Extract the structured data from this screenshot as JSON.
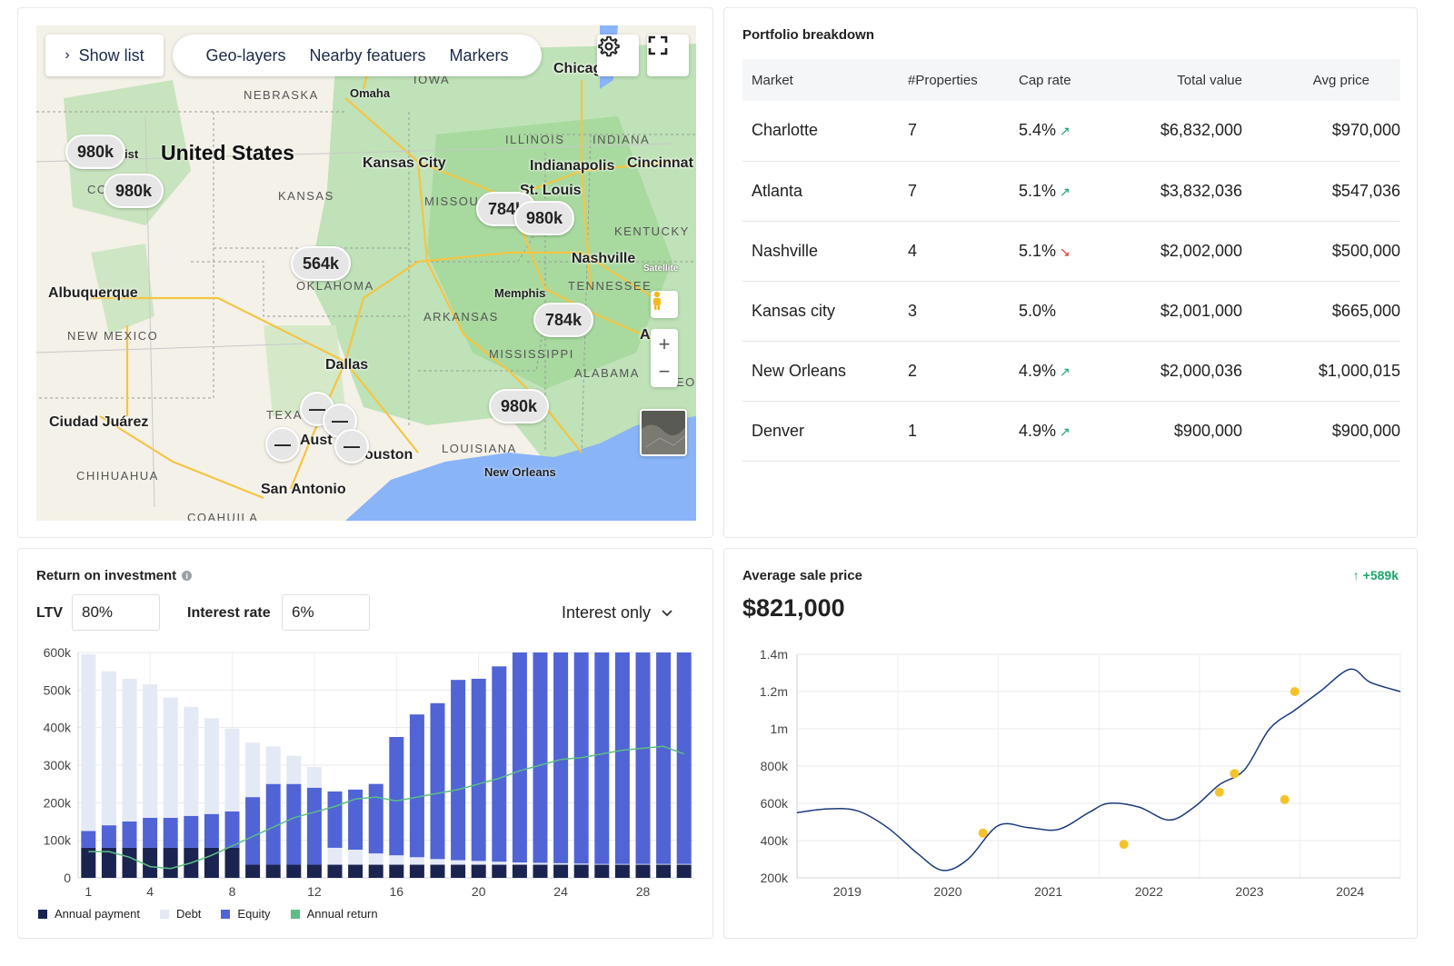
{
  "map": {
    "show_list_label": "Show list",
    "tabs": [
      "Geo-layers",
      "Nearby featuers",
      "Markers"
    ],
    "settings_icon": "gear-icon",
    "fullscreen_icon": "fullscreen-icon",
    "zoom_in": "+",
    "zoom_out": "−",
    "satellite_label": "Satellite",
    "labels": {
      "country": "United States",
      "nebraska": "NEBRASKA",
      "iowa": "IOWA",
      "omaha": "Omaha",
      "illinois": "ILLINOIS",
      "indiana": "INDIANA",
      "chicago": "Chicag",
      "kansas_city": "Kansas City",
      "indianapolis": "Indianapolis",
      "cincinnati": "Cincinnat",
      "kansas": "KANSAS",
      "missouri": "MISSOU",
      "st_louis": "St. Louis",
      "kentucky": "KENTUCKY",
      "nashville": "Nashville",
      "oklahoma": "OKLAHOMA",
      "tennessee": "TENNESSEE",
      "memphis": "Memphis",
      "arkansas": "ARKANSAS",
      "albuquerque": "Albuquerque",
      "new_mexico": "NEW MEXICO",
      "mississippi": "MISSISSIPPI",
      "atlanta": "A  ta",
      "alabama": "ALABAMA",
      "dallas": "Dallas",
      "geo": "EOI",
      "texas": "TEXA",
      "austin": "Aust",
      "houston": "ouston",
      "louisiana": "LOUISIANA",
      "ciudad_juarez": "Ciudad Juárez",
      "new_orleans": "New Orleans",
      "chihuahua": "CHIHUAHUA",
      "san_antonio": "San Antonio",
      "coahuila": "COAHUILA",
      "co": "CO",
      "ist": "ist"
    },
    "clusters": [
      "980k",
      "980k",
      "784k",
      "980k",
      "564k",
      "784k",
      "980k"
    ],
    "dash_label": "—"
  },
  "portfolio": {
    "title": "Portfolio breakdown",
    "columns": [
      "Market",
      "#Properties",
      "Cap rate",
      "Total value",
      "Avg price"
    ],
    "rows": [
      {
        "market": "Charlotte",
        "properties": "7",
        "cap_rate": "5.4%",
        "trend": "up",
        "total_value": "$6,832,000",
        "avg_price": "$970,000"
      },
      {
        "market": "Atlanta",
        "properties": "7",
        "cap_rate": "5.1%",
        "trend": "up",
        "total_value": "$3,832,036",
        "avg_price": "$547,036"
      },
      {
        "market": "Nashville",
        "properties": "4",
        "cap_rate": "5.1%",
        "trend": "down",
        "total_value": "$2,002,000",
        "avg_price": "$500,000"
      },
      {
        "market": "Kansas city",
        "properties": "3",
        "cap_rate": "5.0%",
        "trend": "none",
        "total_value": "$2,001,000",
        "avg_price": "$665,000"
      },
      {
        "market": "New Orleans",
        "properties": "2",
        "cap_rate": "4.9%",
        "trend": "up",
        "total_value": "$2,000,036",
        "avg_price": "$1,000,015"
      },
      {
        "market": "Denver",
        "properties": "1",
        "cap_rate": "4.9%",
        "trend": "up",
        "total_value": "$900,000",
        "avg_price": "$900,000"
      }
    ],
    "trend_up_glyph": "↗",
    "trend_down_glyph": "↘"
  },
  "roi": {
    "title": "Return on investment",
    "info_glyph": "i",
    "ltv_label": "LTV",
    "ltv_value": "80%",
    "interest_label": "Interest rate",
    "interest_value": "6%",
    "mode_value": "Interest only",
    "legend": [
      "Annual payment",
      "Debt",
      "Equity",
      "Annual return"
    ],
    "colors": {
      "annual_payment": "#1b2350",
      "debt": "#e4e9f6",
      "equity": "#5064d6",
      "annual_return": "#5cbf83"
    }
  },
  "avg_sale": {
    "title": "Average sale price",
    "value": "$821,000",
    "delta": "↑ +589k"
  },
  "chart_data": [
    {
      "type": "bar",
      "title": "Return on investment",
      "stacked": true,
      "x": [
        1,
        2,
        3,
        4,
        5,
        6,
        7,
        8,
        9,
        10,
        11,
        12,
        13,
        14,
        15,
        16,
        17,
        18,
        19,
        20,
        21,
        22,
        23,
        24,
        25,
        26,
        27,
        28,
        29,
        30
      ],
      "x_ticks": [
        "1",
        "4",
        "8",
        "12",
        "16",
        "20",
        "24",
        "28"
      ],
      "y_ticks": [
        "0",
        "100k",
        "200k",
        "300k",
        "400k",
        "500k",
        "600k"
      ],
      "ylim": [
        0,
        600000
      ],
      "series": [
        {
          "name": "Annual payment",
          "values": [
            80000,
            80000,
            80000,
            80000,
            80000,
            80000,
            80000,
            80000,
            35000,
            35000,
            35000,
            35000,
            35000,
            35000,
            35000,
            35000,
            35000,
            35000,
            35000,
            35000,
            35000,
            35000,
            35000,
            35000,
            35000,
            35000,
            35000,
            35000,
            35000,
            35000
          ]
        },
        {
          "name": "Debt",
          "values": [
            470000,
            410000,
            380000,
            355000,
            320000,
            290000,
            255000,
            220000,
            145000,
            100000,
            75000,
            55000,
            45000,
            40000,
            30000,
            25000,
            20000,
            15000,
            12000,
            10000,
            8000,
            6000,
            5000,
            4000,
            3000,
            2000,
            2000,
            2000,
            2000,
            2000
          ]
        },
        {
          "name": "Equity",
          "values": [
            45000,
            60000,
            70000,
            80000,
            80000,
            85000,
            90000,
            97000,
            180000,
            215000,
            215000,
            205000,
            150000,
            160000,
            185000,
            315000,
            380000,
            415000,
            480000,
            485000,
            520000,
            560000,
            590000,
            590000,
            590000,
            590000,
            590000,
            590000,
            590000,
            590000
          ]
        }
      ],
      "series_visible_heights": [
        125000,
        140000,
        150000,
        160000,
        160000,
        165000,
        170000,
        177000,
        215000,
        250000,
        250000,
        240000,
        195000,
        195000,
        220000,
        360000,
        420000,
        455000,
        520000,
        520000,
        555000,
        595000,
        625000,
        625000,
        625000,
        625000,
        625000,
        625000,
        625000,
        625000
      ],
      "line": {
        "name": "Annual return",
        "values": [
          70000,
          70000,
          55000,
          30000,
          25000,
          40000,
          60000,
          85000,
          110000,
          135000,
          160000,
          175000,
          190000,
          210000,
          215000,
          205000,
          215000,
          225000,
          235000,
          250000,
          265000,
          285000,
          300000,
          315000,
          320000,
          330000,
          340000,
          345000,
          350000,
          330000
        ]
      }
    },
    {
      "type": "line",
      "title": "Average sale price",
      "x_ticks": [
        "2019",
        "2020",
        "2021",
        "2022",
        "2023",
        "2024"
      ],
      "y_ticks": [
        "200k",
        "400k",
        "600k",
        "800k",
        "1m",
        "1.2m",
        "1.4m"
      ],
      "ylim": [
        200000,
        1400000
      ],
      "xlim": [
        2018.5,
        2024.5
      ],
      "line_points": [
        [
          2018.5,
          550000
        ],
        [
          2018.8,
          570000
        ],
        [
          2019.1,
          560000
        ],
        [
          2019.4,
          470000
        ],
        [
          2019.7,
          330000
        ],
        [
          2019.95,
          240000
        ],
        [
          2020.2,
          300000
        ],
        [
          2020.5,
          480000
        ],
        [
          2020.8,
          470000
        ],
        [
          2021.1,
          460000
        ],
        [
          2021.4,
          550000
        ],
        [
          2021.6,
          600000
        ],
        [
          2021.9,
          580000
        ],
        [
          2022.2,
          510000
        ],
        [
          2022.45,
          580000
        ],
        [
          2022.7,
          700000
        ],
        [
          2022.95,
          780000
        ],
        [
          2023.2,
          1000000
        ],
        [
          2023.45,
          1100000
        ],
        [
          2023.7,
          1200000
        ],
        [
          2024.0,
          1320000
        ],
        [
          2024.2,
          1250000
        ],
        [
          2024.5,
          1200000
        ]
      ],
      "scatter_points": [
        [
          2020.35,
          440000
        ],
        [
          2021.75,
          380000
        ],
        [
          2022.7,
          660000
        ],
        [
          2022.85,
          760000
        ],
        [
          2023.35,
          620000
        ],
        [
          2023.45,
          1200000
        ]
      ],
      "colors": {
        "line": "#1b3a7a",
        "points": "#f5c22a"
      }
    }
  ]
}
